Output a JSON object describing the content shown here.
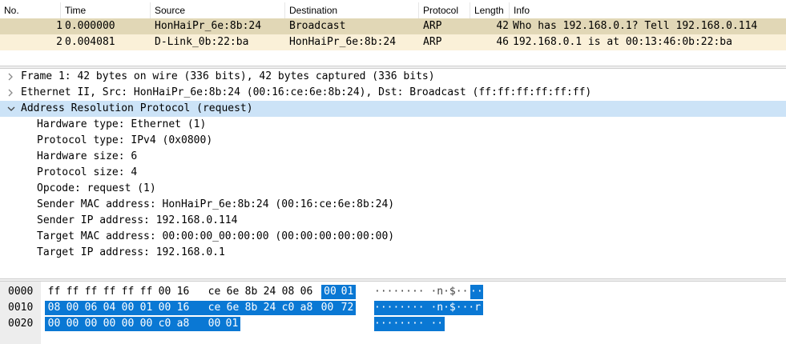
{
  "columns": {
    "no": "No.",
    "time": "Time",
    "source": "Source",
    "destination": "Destination",
    "protocol": "Protocol",
    "length": "Length",
    "info": "Info"
  },
  "packets": [
    {
      "no": "1",
      "time": "0.000000",
      "source": "HonHaiPr_6e:8b:24",
      "destination": "Broadcast",
      "protocol": "ARP",
      "length": "42",
      "info": "Who has 192.168.0.1? Tell 192.168.0.114"
    },
    {
      "no": "2",
      "time": "0.004081",
      "source": "D-Link_0b:22:ba",
      "destination": "HonHaiPr_6e:8b:24",
      "protocol": "ARP",
      "length": "46",
      "info": "192.168.0.1 is at 00:13:46:0b:22:ba"
    }
  ],
  "details": {
    "frame": "Frame 1: 42 bytes on wire (336 bits), 42 bytes captured (336 bits)",
    "ethernet": "Ethernet II, Src: HonHaiPr_6e:8b:24 (00:16:ce:6e:8b:24), Dst: Broadcast (ff:ff:ff:ff:ff:ff)",
    "arp": "Address Resolution Protocol (request)",
    "arp_fields": [
      "Hardware type: Ethernet (1)",
      "Protocol type: IPv4 (0x0800)",
      "Hardware size: 6",
      "Protocol size: 4",
      "Opcode: request (1)",
      "Sender MAC address: HonHaiPr_6e:8b:24 (00:16:ce:6e:8b:24)",
      "Sender IP address: 192.168.0.114",
      "Target MAC address: 00:00:00_00:00:00 (00:00:00:00:00:00)",
      "Target IP address: 192.168.0.1"
    ]
  },
  "bytes": [
    {
      "offset": "0000",
      "hex": [
        "ff",
        "ff",
        "ff",
        "ff",
        "ff",
        "ff",
        "00",
        "16",
        "ce",
        "6e",
        "8b",
        "24",
        "08",
        "06",
        "00",
        "01"
      ],
      "ascii_plain": "········ ·n·$··",
      "ascii_sel": "··"
    },
    {
      "offset": "0010",
      "hex": [
        "08",
        "00",
        "06",
        "04",
        "00",
        "01",
        "00",
        "16",
        "ce",
        "6e",
        "8b",
        "24",
        "c0",
        "a8",
        "00",
        "72"
      ],
      "ascii_plain": "",
      "ascii_sel": "········ ·n·$···r"
    },
    {
      "offset": "0020",
      "hex": [
        "00",
        "00",
        "00",
        "00",
        "00",
        "00",
        "c0",
        "a8",
        "00",
        "01"
      ],
      "ascii_plain": "",
      "ascii_sel": "········ ··"
    }
  ],
  "colors": {
    "row1_bg": "#e1d7b6",
    "row2_bg": "#faf0d8",
    "tree_selected_bg": "#cce3f7",
    "bytes_selected_bg": "#0a78d4"
  }
}
